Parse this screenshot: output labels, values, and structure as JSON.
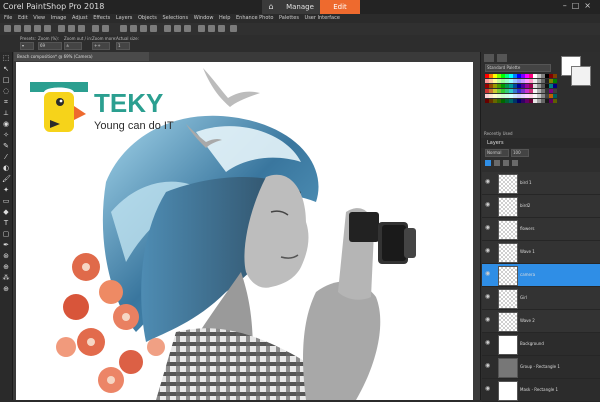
{
  "app": {
    "title": "Corel PaintShop Pro 2018"
  },
  "workspace_tabs": [
    {
      "label": "Manage"
    },
    {
      "label": "Edit"
    }
  ],
  "menu": [
    {
      "label": "File"
    },
    {
      "label": "Edit"
    },
    {
      "label": "View"
    },
    {
      "label": "Image"
    },
    {
      "label": "Adjust"
    },
    {
      "label": "Effects"
    },
    {
      "label": "Layers"
    },
    {
      "label": "Objects"
    },
    {
      "label": "Selections"
    },
    {
      "label": "Window"
    },
    {
      "label": "Help"
    },
    {
      "label": "Enhance Photo"
    },
    {
      "label": "Palettes"
    },
    {
      "label": "User Interface"
    }
  ],
  "options_bar": {
    "presets_label": "Presets:",
    "zoom_label": "Zoom (%):",
    "zoom_in_out_label": "Zoom out / in:",
    "zoom_more_label": "Zoom more:",
    "actual_size_label": "Actual size:"
  },
  "document": {
    "tab_label": "Beach composition* @ 69% (Camera)"
  },
  "canvas": {
    "logo_text": "TEKY",
    "tagline": "Young can do IT"
  },
  "colors": {
    "accent": "#ee6a2e",
    "selection": "#2f8ee6",
    "logo_teal": "#2b9f90",
    "logo_yellow": "#f6d31a"
  },
  "materials": {
    "style_label": "Standard Palette",
    "recently_used_label": "Recently Used"
  },
  "layers_panel": {
    "title": "Layers",
    "blend_mode": "Normal",
    "opacity": "100",
    "layers": [
      {
        "name": "bird 1"
      },
      {
        "name": "bird2"
      },
      {
        "name": "flowers"
      },
      {
        "name": "Wave 1"
      },
      {
        "name": "camera"
      },
      {
        "name": "Girl"
      },
      {
        "name": "Wave 2"
      },
      {
        "name": "Background"
      },
      {
        "name": "Group - Rectangle 1"
      },
      {
        "name": "Mask - Rectangle 1"
      }
    ]
  }
}
